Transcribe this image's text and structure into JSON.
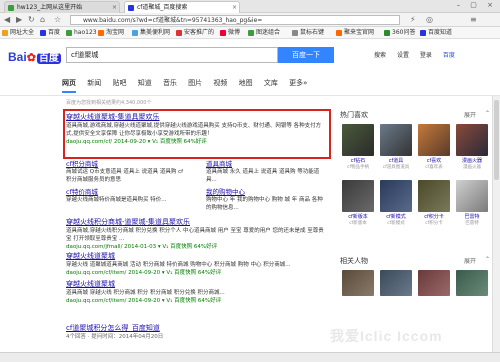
{
  "browser": {
    "tabs": [
      {
        "label": "hw123_上网从这里开始",
        "active": false
      },
      {
        "label": "cf道聚城_百度搜索",
        "active": true
      }
    ],
    "url": "www.baidu.com/s?wd=cf道聚城&tn=95741363_hao_pg&ie=",
    "bookmarks": [
      "网址大全",
      "百度",
      "hao123",
      "淘宝网",
      "集美便利网",
      "安客推广的",
      "微博",
      "图迷组合",
      "鼠标右键",
      "聚来宝官网",
      "360问答",
      "百度知道"
    ]
  },
  "header": {
    "logo_bai": "Bai",
    "logo_paw": "✿",
    "logo_du": "百度",
    "search_value": "cf道聚城",
    "search_button": "百度一下",
    "toplinks": [
      "搜索",
      "设置",
      "登录",
      "百度"
    ]
  },
  "tabs": [
    "网页",
    "新闻",
    "贴吧",
    "知道",
    "音乐",
    "图片",
    "视频",
    "地图",
    "文库",
    "更多»"
  ],
  "result_count": "百度为您找到相关结果约4,340,000个",
  "results": [
    {
      "title": "穿越火线道聚城-集道具聚欢乐",
      "desc": "道具商城,游戏商城,穿越火线道聚城,提供穿越火线游戏道具购买 支持Q币支、财付通、网银等 各种支付方式,提供安全文享保障 让你尽享极致小享受游戏所带的乐趣！",
      "url": "daoju.qq.com/cf/  2014-09-20  ▾  V₁  百度快照  64%好评"
    }
  ],
  "subs": [
    {
      "title": "cf积分商城",
      "desc": "商城试运 Q币支意道具 道具上 说道具 道具购 cf积分商城服务员的意思"
    },
    {
      "title": "道具商城",
      "desc": "道具商城 永久 道具上 说道具 道具购 等功能道具..."
    },
    {
      "title": "cf特价商城",
      "desc": "穿越火线商城特价商城是道具购买 特价..."
    },
    {
      "title": "我的购物中心",
      "desc": "购物中心 年 我的购物中心 购物 城 年 商品 各种的购物信息..."
    }
  ],
  "results2": [
    {
      "title": "穿越火线积分商城-道聚城-集道具聚欢乐",
      "desc": "道具商城,穿越火线积分商城 积分兑换 积分个人 中心道具商城 用户 至宝 尊爱的用户 您的还未是成 至尊贵宝 打开领取至尊贵宝 ...",
      "url": "daoju.qq.com/jfmall/  2014-01-03  ▾  V₁  百度快照  64%好评"
    },
    {
      "title": "穿越火线道聚城",
      "desc": "穿越火线 道聚城道具商城 活动 积分商城 特价商城 购物中心 积分商城 购物 中心 积分商城...",
      "url": "daoju.qq.com/cf/item/  2014-09-20  ▾  V₁  百度快照  64%好评"
    },
    {
      "title": "穿越火线道聚城",
      "desc": "道具商城 穿越火线 积分商城 积分 积分商城 积分兑换 积分商城...",
      "url": "daoju.qq.com/cf/item/  2014-09-20  ▾  V₁  百度快照  64%好评"
    },
    {
      "title": "cf道聚城积分怎么得_百度知道",
      "desc": "",
      "url": "4个回答 · 提问时间：2014年04月20日"
    }
  ],
  "sidebar": {
    "title": "热门喜欢",
    "more": "展开",
    "row1": [
      {
        "name": "cf钻石",
        "sub": "cf物品手柄"
      },
      {
        "name": "cf道具",
        "sub": "cf道具图道具"
      },
      {
        "name": "cf喜欢",
        "sub": "cf喜欢表"
      },
      {
        "name": "漫画火器",
        "sub": "漫画火器"
      }
    ],
    "row2": [
      {
        "name": "cf新版本",
        "sub": "cf新版本"
      },
      {
        "name": "cf新模式",
        "sub": "cf新模式"
      },
      {
        "name": "cf积分卡",
        "sub": "cf积分卡"
      },
      {
        "name": "巴雷特",
        "sub": "巴雷特"
      }
    ],
    "related_title": "相关人物",
    "related_more": "展开"
  },
  "watermark": "我爱Iclic Iccom",
  "colors": {
    "accent": "#3385ff",
    "link": "#1a0dab",
    "highlight": "#d9231d",
    "url": "#008000"
  }
}
